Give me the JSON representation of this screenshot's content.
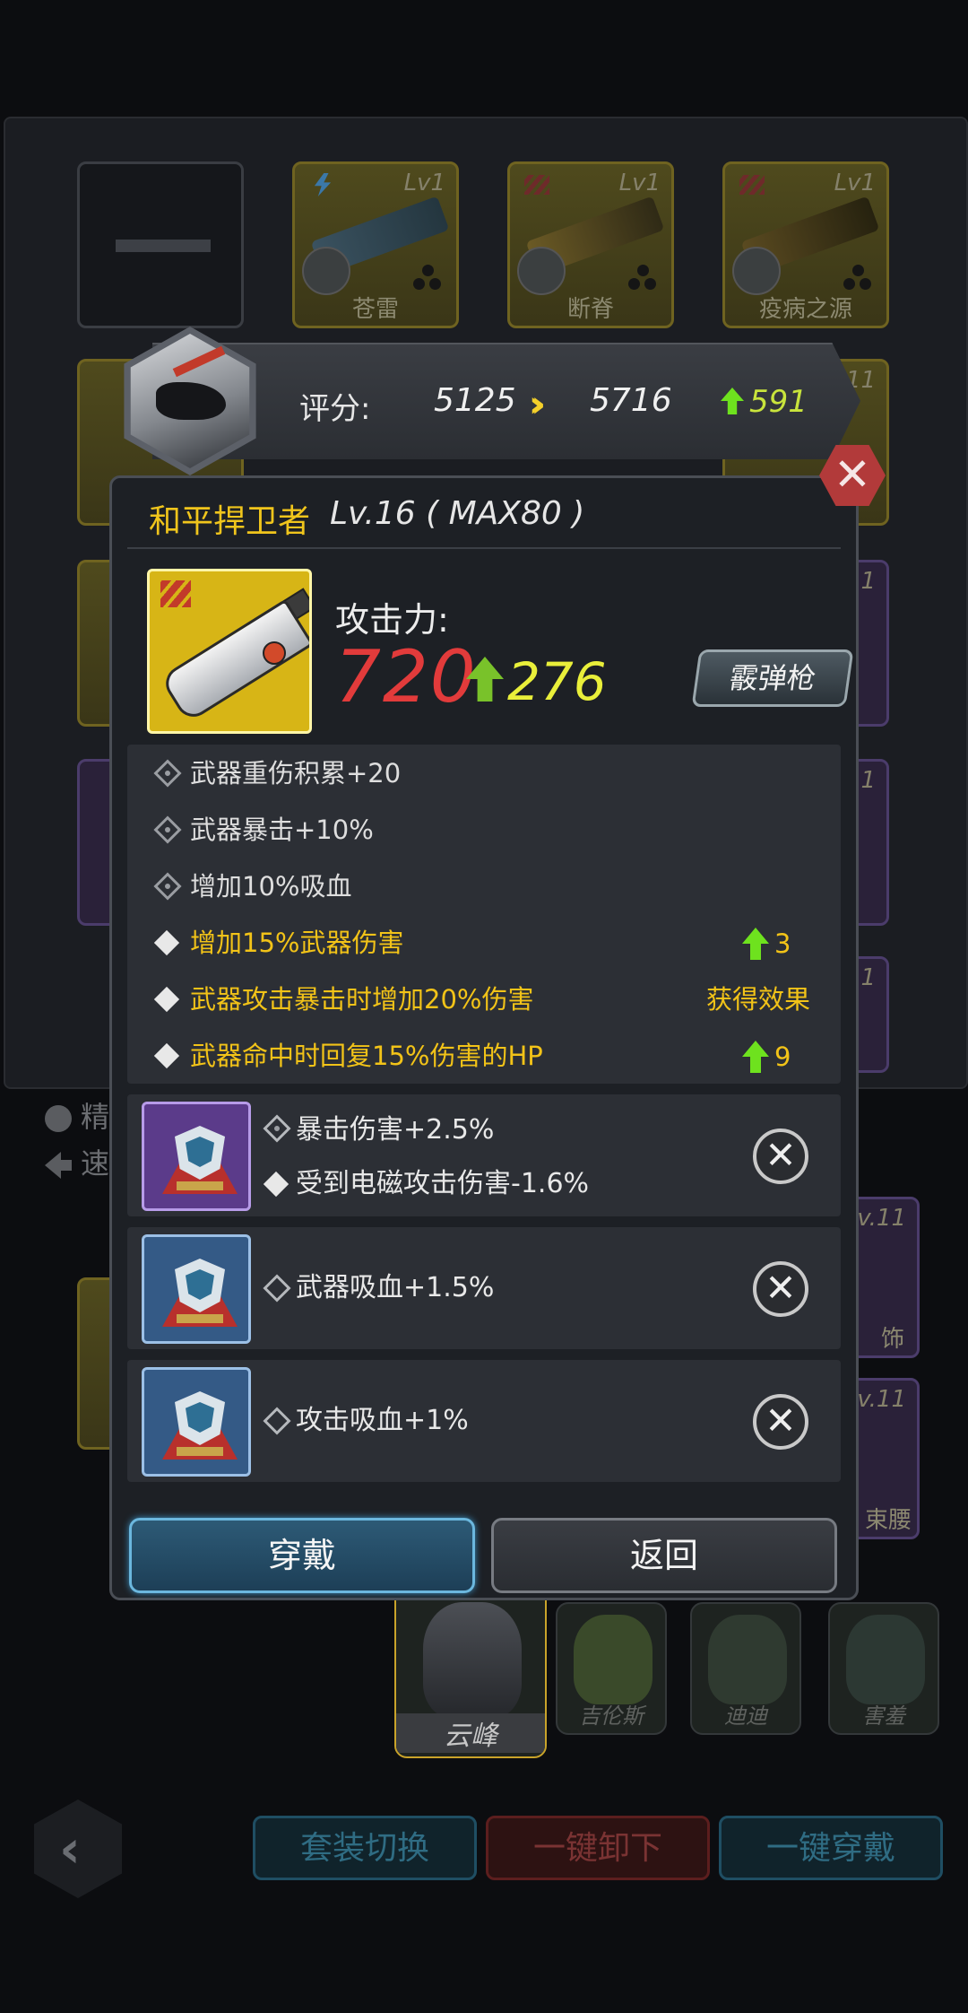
{
  "background": {
    "slots_row1": [
      {
        "name": "",
        "level": ""
      },
      {
        "name": "苍雷",
        "level": "Lv1"
      },
      {
        "name": "断脊",
        "level": "Lv1"
      },
      {
        "name": "疫病之源",
        "level": "Lv1"
      }
    ],
    "side_level_labels": [
      "v11",
      "1",
      "1",
      "1"
    ],
    "side_labels": [
      "精",
      "速"
    ],
    "equip_labels": [
      "饰",
      "束腰"
    ],
    "equip_levels": [
      "v.11",
      "v.11"
    ],
    "heroes": [
      "云峰",
      "吉伦斯",
      "迪迪",
      "害羞"
    ],
    "bottom_buttons": [
      "套装切换",
      "一键卸下",
      "一键穿戴"
    ]
  },
  "score": {
    "label": "评分:",
    "old": "5125",
    "new": "5716",
    "diff": "591"
  },
  "item": {
    "name": "和平捍卫者",
    "level_text": "Lv.16 ( MAX80 )",
    "attack_label": "攻击力:",
    "attack_value": "720",
    "attack_gain": "276",
    "weapon_type": "霰弹枪"
  },
  "attributes": [
    {
      "text": "武器重伤积累+20",
      "style": "gray",
      "icon": "lock-diamond-icon",
      "right": ""
    },
    {
      "text": "武器暴击+10%",
      "style": "gray",
      "icon": "lock-diamond-icon",
      "right": ""
    },
    {
      "text": "增加10%吸血",
      "style": "gray",
      "icon": "lock-diamond-icon",
      "right": ""
    },
    {
      "text": "增加15%武器伤害",
      "style": "yellow",
      "icon": "diamond-icon",
      "right": "3"
    },
    {
      "text": "武器攻击暴击时增加20%伤害",
      "style": "yellow",
      "icon": "diamond-icon",
      "right": "获得效果"
    },
    {
      "text": "武器命中时回复15%伤害的HP",
      "style": "yellow",
      "icon": "diamond-icon",
      "right": "9"
    }
  ],
  "chips": [
    {
      "rarity": "purple",
      "lines": [
        "暴击伤害+2.5%",
        "受到电磁攻击伤害-1.6%"
      ]
    },
    {
      "rarity": "blue",
      "lines": [
        "武器吸血+1.5%"
      ]
    },
    {
      "rarity": "blue",
      "lines": [
        "攻击吸血+1%"
      ]
    }
  ],
  "buttons": {
    "equip": "穿戴",
    "back": "返回",
    "close": "✕",
    "unequip": "✕"
  },
  "colors": {
    "accent_yellow": "#f2c318",
    "attack_red": "#e23b3b",
    "gain_green": "#6ee21e",
    "primary_blue": "#6bb7de"
  }
}
